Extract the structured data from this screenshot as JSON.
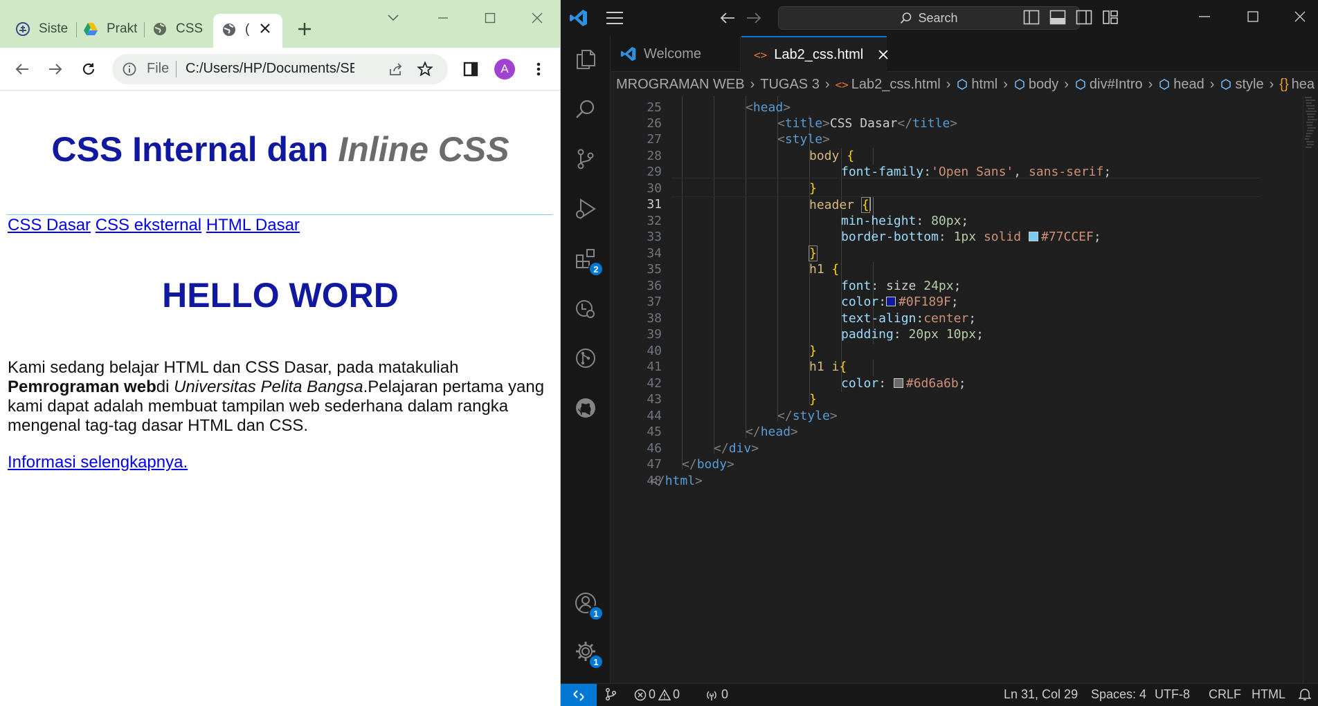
{
  "browser": {
    "tabs": [
      {
        "title": "Siste"
      },
      {
        "title": "Prakt"
      },
      {
        "title": "CSS I"
      },
      {
        "title": "("
      }
    ],
    "address": {
      "scheme": "File",
      "url": "C:/Users/HP/Documents/SE..."
    },
    "avatar_letter": "A",
    "page": {
      "heading_normal": "CSS Internal dan ",
      "heading_italic": "Inline CSS",
      "nav_links": [
        "CSS Dasar",
        "CSS eksternal",
        "HTML Dasar"
      ],
      "hello": "HELLO WORD",
      "para_1": "Kami sedang belajar HTML dan CSS Dasar, pada matakuliah ",
      "para_bold": "Pemrograman web",
      "para_2": "di ",
      "para_italic": "Universitas Pelita Bangsa",
      "para_3": ".Pelajaran pertama yang kami dapat adalah membuat tampilan web sederhana dalam rangka mengenal tag-tag dasar HTML dan CSS.",
      "more_link": "Informasi selengkapnya."
    }
  },
  "vscode": {
    "search_label": "Search",
    "tabs": {
      "welcome": "Welcome",
      "active": "Lab2_css.html"
    },
    "breadcrumb": [
      "MROGRAMAN WEB",
      "TUGAS 3",
      "Lab2_css.html",
      "html",
      "body",
      "div#Intro",
      "head",
      "style",
      "hea"
    ],
    "activity_badges": {
      "extensions": "2",
      "accounts": "1",
      "manage": "1"
    },
    "line_numbers": [
      "25",
      "26",
      "27",
      "28",
      "29",
      "30",
      "31",
      "32",
      "33",
      "34",
      "35",
      "36",
      "37",
      "38",
      "39",
      "40",
      "41",
      "42",
      "43",
      "44",
      "45",
      "46",
      "47",
      "48"
    ],
    "code": {
      "l25_tag": "head",
      "l26_tag": "title",
      "l26_text": "CSS Dasar",
      "l27_tag": "style",
      "l28_sel": "body",
      "l29_prop": "font-family",
      "l29_str": "'Open Sans'",
      "l29_rest": "sans-serif",
      "l31_sel": "header",
      "l32_prop": "min-height",
      "l32_val": "80px",
      "l33_prop": "border-bottom",
      "l33_num": "1px",
      "l33_kw": "solid",
      "l33_color": "#77CCEF",
      "l35_sel": "h1",
      "l36_prop": "font",
      "l36_kw": "size",
      "l36_val": "24px",
      "l37_prop": "color",
      "l37_color": "#0F189F",
      "l38_prop": "text-align",
      "l38_val": "center",
      "l39_prop": "padding",
      "l39_val": "20px 10px",
      "l41_sel": "h1 i",
      "l42_prop": "color",
      "l42_color": "#6d6a6b",
      "l44_tag": "style",
      "l45_tag": "head",
      "l46_tag": "div",
      "l47_tag": "body",
      "l48_tag": "html"
    },
    "status": {
      "errors": "0",
      "warnings": "0",
      "ports": "0",
      "position": "Ln 31, Col 29",
      "spaces": "Spaces: 4",
      "encoding": "UTF-8",
      "eol": "CRLF",
      "language": "HTML"
    }
  },
  "colors": {
    "heading_blue": "#0F189F",
    "italic_gray": "#6d6a6b",
    "border_blue": "#77CCEF",
    "chrome_frame": "#cfe8c6",
    "vscode_accent": "#0078d4"
  }
}
